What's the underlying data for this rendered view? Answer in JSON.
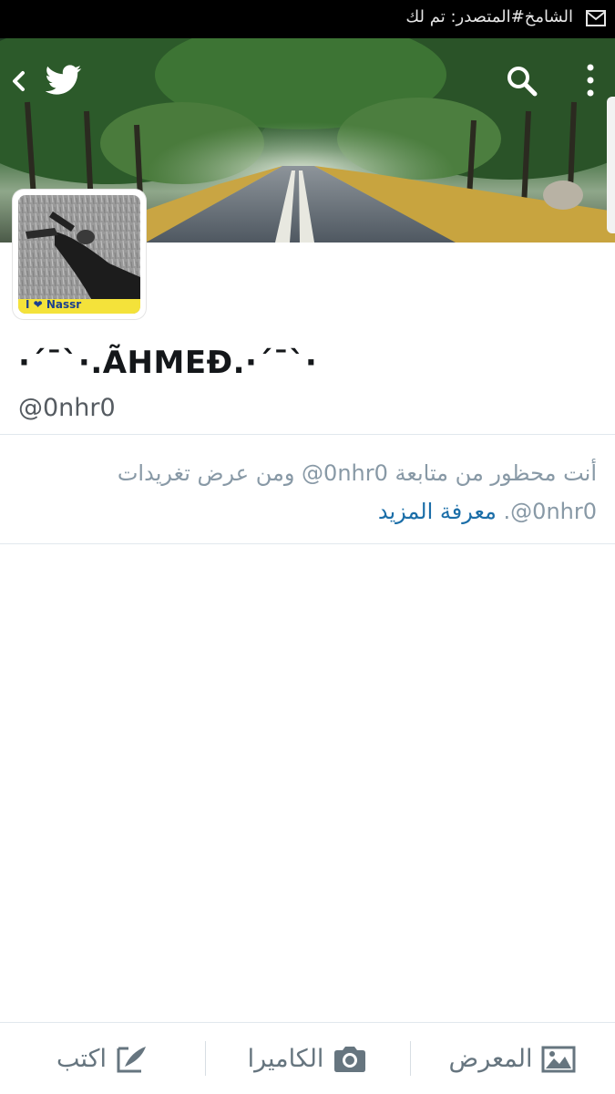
{
  "status_bar": {
    "notification_text": "الشامخ#المتصدر: تم لك",
    "icon": "mail-icon"
  },
  "header": {
    "back_icon": "chevron-left-icon",
    "logo_icon": "twitter-bird-icon",
    "search_icon": "search-icon",
    "more_icon": "more-vertical-icon"
  },
  "profile": {
    "display_name": "·´¯`·.ÃHMEĐ.·´¯`·",
    "handle": "@0nhr0",
    "avatar_caption": "I ❤ Nassr",
    "avatar_caption_color": "#f4e23a"
  },
  "blocked_notice": {
    "line1": "أنت محظور من متابعة ‎@0nhr0‏ ومن عرض تغريدات",
    "line2_handle": "‎@0nhr0‏.",
    "learn_more": "معرفة المزيد",
    "text_color": "#8899a6",
    "link_color": "#1b6ea8"
  },
  "bottom_bar": {
    "compose_label": "اكتب",
    "compose_icon": "compose-icon",
    "camera_label": "الكاميرا",
    "camera_icon": "camera-icon",
    "gallery_label": "المعرض",
    "gallery_icon": "gallery-icon"
  }
}
